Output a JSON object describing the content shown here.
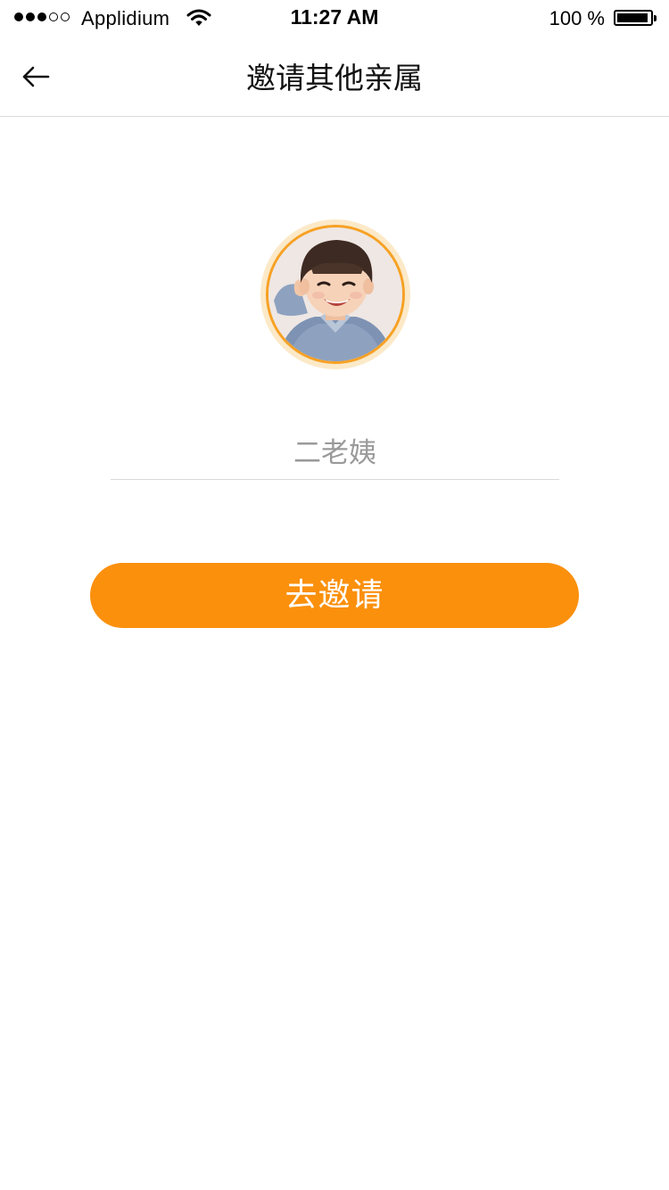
{
  "status_bar": {
    "carrier": "Applidium",
    "time": "11:27 AM",
    "battery": "100 %",
    "signal_bars_filled": 3,
    "signal_bars_total": 5,
    "wifi_icon": "wifi-icon",
    "battery_level": 1.0
  },
  "nav": {
    "title": "邀请其他亲属",
    "back_icon": "back-arrow-icon"
  },
  "avatar": {
    "ring_color": "#fbe9c8",
    "border_color": "#f7a124"
  },
  "form": {
    "name_placeholder": "二老姨",
    "name_value": ""
  },
  "actions": {
    "invite_label": "去邀请",
    "invite_color": "#fb900d"
  }
}
